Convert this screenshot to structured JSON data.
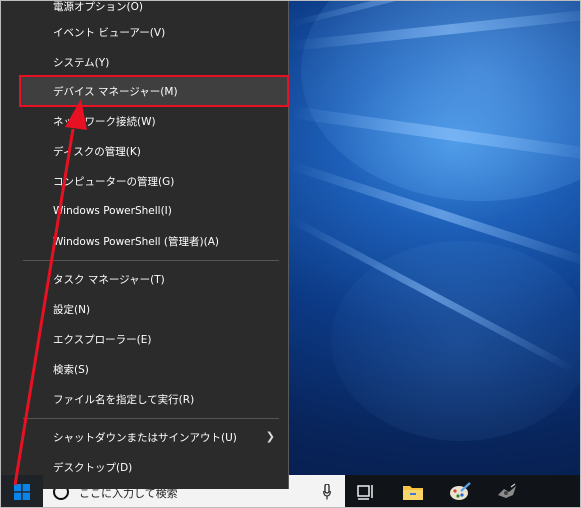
{
  "menu": {
    "items": [
      {
        "label": "電源オプション(O)"
      },
      {
        "label": "イベント ビューアー(V)"
      },
      {
        "label": "システム(Y)"
      },
      {
        "label": "デバイス マネージャー(M)"
      },
      {
        "label": "ネットワーク接続(W)"
      },
      {
        "label": "ディスクの管理(K)"
      },
      {
        "label": "コンピューターの管理(G)"
      },
      {
        "label": "Windows PowerShell(I)"
      },
      {
        "label": "Windows PowerShell (管理者)(A)"
      },
      {
        "label": "タスク マネージャー(T)"
      },
      {
        "label": "設定(N)"
      },
      {
        "label": "エクスプローラー(E)"
      },
      {
        "label": "検索(S)"
      },
      {
        "label": "ファイル名を指定して実行(R)"
      },
      {
        "label": "シャットダウンまたはサインアウト(U)"
      },
      {
        "label": "デスクトップ(D)"
      }
    ],
    "highlighted_item": "デバイス マネージャー(M)"
  },
  "taskbar": {
    "search_placeholder": "ここに入力して検索"
  },
  "colors": {
    "menu_bg": "#2b2b2b",
    "highlight_border": "#e81123",
    "annotation_arrow": "#e81123",
    "start_logo": "#0a84e8"
  },
  "icons": [
    "windows-logo-icon",
    "search-icon",
    "microphone-icon",
    "task-view-icon",
    "file-explorer-icon",
    "paint-icon",
    "app-icon",
    "chevron-right-icon"
  ]
}
